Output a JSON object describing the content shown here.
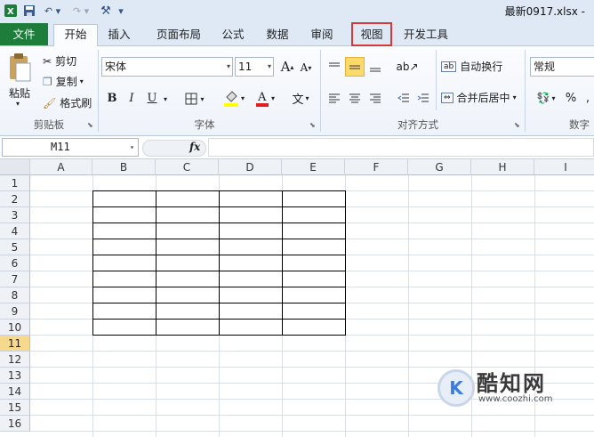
{
  "titlebar": {
    "filename": "最新0917.xlsx",
    "trailing": "-",
    "qa_items": [
      "excel-logo",
      "save-icon",
      "undo-icon",
      "redo-icon",
      "customize-icon"
    ]
  },
  "tabs": [
    {
      "label": "文件"
    },
    {
      "label": "开始"
    },
    {
      "label": "插入"
    },
    {
      "label": "页面布局"
    },
    {
      "label": "公式"
    },
    {
      "label": "数据"
    },
    {
      "label": "审阅"
    },
    {
      "label": "视图"
    },
    {
      "label": "开发工具"
    }
  ],
  "clipboard": {
    "paste": "粘贴",
    "cut": "剪切",
    "copy": "复制",
    "format_painter": "格式刷",
    "group": "剪贴板"
  },
  "font": {
    "name": "宋体",
    "size": "11",
    "grow": "A",
    "shrink": "A",
    "bold": "B",
    "italic": "I",
    "underline": "U",
    "wen": "文",
    "group": "字体"
  },
  "alignment": {
    "wrap": "自动换行",
    "merge": "合并后居中",
    "group": "对齐方式"
  },
  "number": {
    "format": "常规",
    "percent": "%",
    "comma": ",",
    "group": "数字"
  },
  "formula_bar": {
    "name_box": "M11",
    "fx": "fx",
    "value": ""
  },
  "sheet": {
    "columns": [
      "A",
      "B",
      "C",
      "D",
      "E",
      "F",
      "G",
      "H",
      "I"
    ],
    "rows": [
      "1",
      "2",
      "3",
      "4",
      "5",
      "6",
      "7",
      "8",
      "9",
      "10",
      "11",
      "12",
      "13",
      "14",
      "15",
      "16"
    ],
    "selected_row": "11"
  },
  "watermark": {
    "logo": "K",
    "name": "酷知网",
    "url": "www.coozhi.com"
  },
  "colors": {
    "file_tab": "#1e7d3b",
    "highlight_box": "#d43a3a",
    "selected_row_header": "#f7d98d"
  }
}
